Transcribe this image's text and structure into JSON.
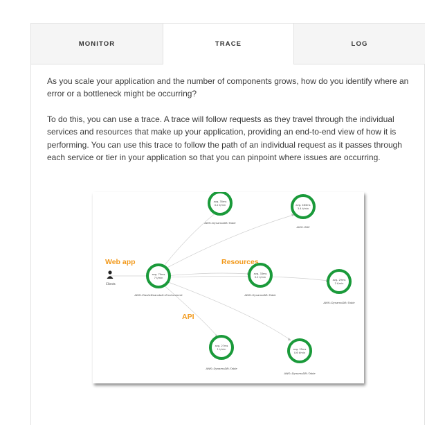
{
  "tabs": [
    {
      "label": "MONITOR",
      "active": false
    },
    {
      "label": "TRACE",
      "active": true
    },
    {
      "label": "LOG",
      "active": false
    }
  ],
  "paragraphs": [
    "As you scale your application and the number of components grows, how do you identify where an error or a bottleneck might be occurring?",
    "To do this, you can use a trace. A trace will follow requests as they travel through the individual services and resources that make up your application, providing an end-to-end view of how it is performing. You can use this trace to follow the path of an individual request as it passes through each service or tier in your application so that you can pinpoint where issues are occurring."
  ],
  "diagram": {
    "labels": {
      "web_app": "Web app",
      "resources": "Resources",
      "api": "API",
      "client": "Clients"
    },
    "nodes": [
      {
        "id": "api",
        "line1": "avg. 79ms",
        "line2": "7 t/min",
        "label": "AWS::ElasticBeanstalk::Environment"
      },
      {
        "id": "ddb-top",
        "line1": "avg. 35ms",
        "line2": "0.2 t/min",
        "label": "AWS::DynamoDB::Table"
      },
      {
        "id": "sns",
        "line1": "avg. 463ms",
        "line2": "3.4 t/min",
        "label": "AWS::SNS"
      },
      {
        "id": "ddb-mid",
        "line1": "avg. 33ms",
        "line2": "0.2 t/min",
        "label": "AWS::DynamoDB::Table"
      },
      {
        "id": "ddb-right",
        "line1": "avg. 29ms",
        "line2": "2 t/min",
        "label": "AWS::DynamoDB::Table"
      },
      {
        "id": "ddb-bottom",
        "line1": "avg. 27ms",
        "line2": "1 t/min",
        "label": "AWS::DynamoDB::Table"
      },
      {
        "id": "ddb-br",
        "line1": "avg. 25ms",
        "line2": "0.6 t/min",
        "label": "AWS::DynamoDB::Table"
      }
    ],
    "colors": {
      "node_ring": "#1a9a3a",
      "accent_label": "#f29a1d",
      "edge": "#cfcfcf"
    }
  }
}
